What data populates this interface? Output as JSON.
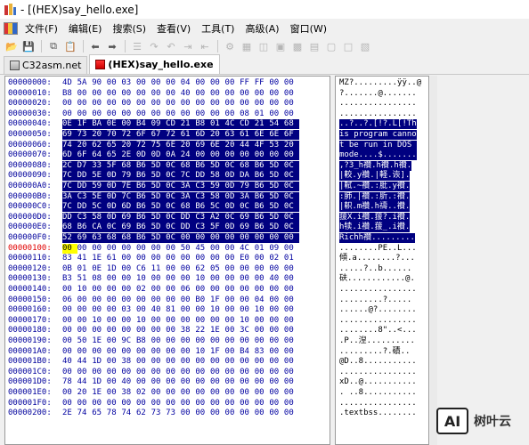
{
  "window": {
    "title": "- [(HEX)say_hello.exe]"
  },
  "menu": [
    {
      "label": "文件(F)",
      "name": "menu-file"
    },
    {
      "label": "编辑(E)",
      "name": "menu-edit"
    },
    {
      "label": "搜索(S)",
      "name": "menu-search"
    },
    {
      "label": "查看(V)",
      "name": "menu-view"
    },
    {
      "label": "工具(T)",
      "name": "menu-tools"
    },
    {
      "label": "高级(A)",
      "name": "menu-advanced"
    },
    {
      "label": "窗口(W)",
      "name": "menu-window"
    }
  ],
  "tabs": [
    {
      "label": "C32asm.net",
      "active": false
    },
    {
      "label": "(HEX)say_hello.exe",
      "active": true
    }
  ],
  "hex_rows": [
    {
      "offset": "00000000:",
      "bytes": "4D 5A 90 00 03 00 00 00 04 00 00 00 FF FF 00 00",
      "ascii": "MZ?.........ÿÿ..@"
    },
    {
      "offset": "00000010:",
      "bytes": "B8 00 00 00 00 00 00 00 40 00 00 00 00 00 00 00",
      "ascii": "?.......@......."
    },
    {
      "offset": "00000020:",
      "bytes": "00 00 00 00 00 00 00 00 00 00 00 00 00 00 00 00",
      "ascii": "................"
    },
    {
      "offset": "00000030:",
      "bytes": "00 00 00 00 00 00 00 00 00 00 00 00 08 01 00 00",
      "ascii": "................"
    },
    {
      "offset": "00000040:",
      "bytes": "0E 1F BA 0E 00 B4 09 CD 21 B8 01 4C CD 21 54 68",
      "ascii": "..?..?.[!?.L[!Th"
    },
    {
      "offset": "00000050:",
      "bytes": "69 73 20 70 72 6F 67 72 61 6D 20 63 61 6E 6E 6F",
      "ascii": "is program canno"
    },
    {
      "offset": "00000060:",
      "bytes": "74 20 62 65 20 72 75 6E 20 69 6E 20 44 4F 53 20",
      "ascii": "t be run in DOS "
    },
    {
      "offset": "00000070:",
      "bytes": "6D 6F 64 65 2E 0D 0D 0A 24 00 00 00 00 00 00 00",
      "ascii": "mode....$......."
    },
    {
      "offset": "00000080:",
      "bytes": "2C D7 33 5F 68 B6 5D 0C 68 B6 5D 0C 68 B6 5D 0C",
      "ascii": ",?3_h禶.h禶.h禶."
    },
    {
      "offset": "00000090:",
      "bytes": "7C DD 5E 0D 79 B6 5D 0C 7C DD 58 0D DA B6 5D 0C",
      "ascii": "|較.y禶.|軽.诙]."
    },
    {
      "offset": "000000A0:",
      "bytes": "7C DD 59 0D 7E B6 5D 0C 3A C3 59 0D 79 B6 5D 0C",
      "ascii": "|軾.~禶.:肶.y禶."
    },
    {
      "offset": "000000B0:",
      "bytes": "3A C3 5E 0D 7C B6 5D 0C 3A C3 58 0D 3A B6 5D 0C",
      "ascii": ":肺.|禶.:肵.:禶."
    },
    {
      "offset": "000000C0:",
      "bytes": "7C DD 5C 0D 6D B6 5D 0C 68 B6 5C 0D 0C B6 5D 0C",
      "ascii": "|軹.m禶.h禱..禶."
    },
    {
      "offset": "000000D0:",
      "bytes": "DD C3 58 0D 69 B6 5D 0C DD C3 A2 0C 69 B6 5D 0C",
      "ascii": "菝X.i禶.菝?.i禶."
    },
    {
      "offset": "000000E0:",
      "bytes": "68 B6 CA 0C 69 B6 5D 0C DD C3 5F 0D 69 B6 5D 0C",
      "ascii": "h犊.i禶.菝_.i禶."
    },
    {
      "offset": "000000F0:",
      "bytes": "52 69 63 68 68 B6 5D 0C 00 00 00 00 00 00 00 00",
      "ascii": "Richh禶........."
    },
    {
      "offset": "00000100:",
      "bytes": "00 00 00 00 00 00 00 00 50 45 00 00 4C 01 09 00",
      "ascii": "........PE..L..."
    },
    {
      "offset": "00000110:",
      "bytes": "83 41 1E 61 00 00 00 00 00 00 00 00 E0 00 02 01",
      "ascii": "傾.a........?..."
    },
    {
      "offset": "00000120:",
      "bytes": "0B 01 0E 1D 00 C6 11 00 00 62 05 00 00 00 00 00",
      "ascii": ".....?..b......"
    },
    {
      "offset": "00000130:",
      "bytes": "B3 51 08 00 00 10 00 00 00 10 00 00 00 00 40 00",
      "ascii": "砆............@."
    },
    {
      "offset": "00000140:",
      "bytes": "00 10 00 00 00 02 00 00 06 00 00 00 00 00 00 00",
      "ascii": "................"
    },
    {
      "offset": "00000150:",
      "bytes": "06 00 00 00 00 00 00 00 00 B0 1F 00 00 04 00 00",
      "ascii": ".........?....."
    },
    {
      "offset": "00000160:",
      "bytes": "00 00 00 00 03 00 40 81 00 00 10 00 00 10 00 00",
      "ascii": "......@?........"
    },
    {
      "offset": "00000170:",
      "bytes": "00 00 10 00 00 10 00 00 00 00 00 00 10 00 00 00",
      "ascii": "................"
    },
    {
      "offset": "00000180:",
      "bytes": "00 00 00 00 00 00 00 00 38 22 1E 00 3C 00 00 00",
      "ascii": "........8\"..<..."
    },
    {
      "offset": "00000190:",
      "bytes": "00 50 1E 00 9C B8 00 00 00 00 00 00 00 00 00 00",
      "ascii": ".P..湼.........."
    },
    {
      "offset": "000001A0:",
      "bytes": "00 00 00 00 00 00 00 00 00 10 1F 00 B4 83 00 00",
      "ascii": ".........?.磧.."
    },
    {
      "offset": "000001B0:",
      "bytes": "40 44 1D 00 38 00 00 00 00 00 00 00 00 00 00 00",
      "ascii": "@D..8..........."
    },
    {
      "offset": "000001C0:",
      "bytes": "00 00 00 00 00 00 00 00 00 00 00 00 00 00 00 00",
      "ascii": "................"
    },
    {
      "offset": "000001D0:",
      "bytes": "78 44 1D 00 40 00 00 00 00 00 00 00 00 00 00 00",
      "ascii": "xD..@..........."
    },
    {
      "offset": "000001E0:",
      "bytes": "00 20 1E 00 38 02 00 00 00 00 00 00 00 00 00 00",
      "ascii": ". ..8..........."
    },
    {
      "offset": "000001F0:",
      "bytes": "00 00 00 00 00 00 00 00 00 00 00 00 00 00 00 00",
      "ascii": "................"
    },
    {
      "offset": "00000200:",
      "bytes": "2E 74 65 78 74 62 73 73 00 00 00 00 00 00 00 00",
      "ascii": ".textbss........"
    }
  ],
  "watermark": {
    "logo": "AI",
    "text": "树叶云"
  }
}
